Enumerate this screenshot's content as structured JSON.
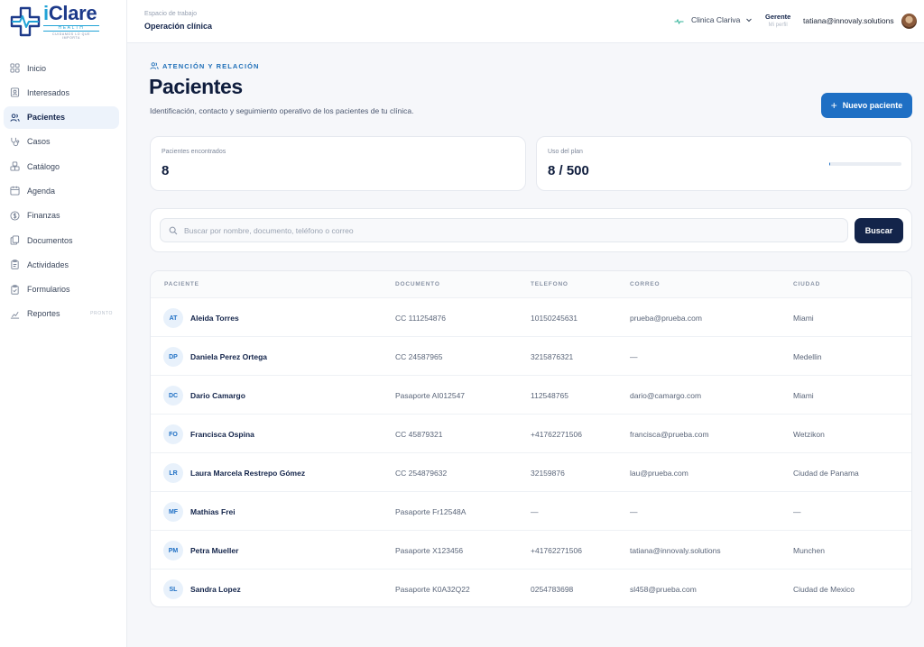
{
  "brand": {
    "name_i": "i",
    "name_rest": "Clare",
    "sub": "HEALTH",
    "tagline": "CUIDAMOS LO QUE IMPORTA"
  },
  "sidebar": {
    "items": [
      {
        "label": "Inicio",
        "icon": "grid-icon",
        "active": false,
        "badge": ""
      },
      {
        "label": "Interesados",
        "icon": "contact-card-icon",
        "active": false,
        "badge": ""
      },
      {
        "label": "Pacientes",
        "icon": "users-icon",
        "active": true,
        "badge": ""
      },
      {
        "label": "Casos",
        "icon": "stethoscope-icon",
        "active": false,
        "badge": ""
      },
      {
        "label": "Catálogo",
        "icon": "boxes-icon",
        "active": false,
        "badge": ""
      },
      {
        "label": "Agenda",
        "icon": "calendar-icon",
        "active": false,
        "badge": ""
      },
      {
        "label": "Finanzas",
        "icon": "dollar-circle-icon",
        "active": false,
        "badge": ""
      },
      {
        "label": "Documentos",
        "icon": "documents-icon",
        "active": false,
        "badge": ""
      },
      {
        "label": "Actividades",
        "icon": "clipboard-icon",
        "active": false,
        "badge": ""
      },
      {
        "label": "Formularios",
        "icon": "clipboard-check-icon",
        "active": false,
        "badge": ""
      },
      {
        "label": "Reportes",
        "icon": "chart-icon",
        "active": false,
        "badge": "PRONTO"
      }
    ]
  },
  "topbar": {
    "workspace_label": "Espacio de trabajo",
    "workspace_name": "Operación clínica",
    "clinic": "Clinica Clariva",
    "role": "Gerente",
    "role_sub": "Mi perfil",
    "email": "tatiana@innovaly.solutions"
  },
  "header": {
    "eyebrow": "ATENCIÓN Y RELACIÓN",
    "title": "Pacientes",
    "description": "Identificación, contacto y seguimiento operativo de los pacientes de tu clínica.",
    "new_button": "Nuevo paciente"
  },
  "stats": {
    "found_label": "Pacientes encontrados",
    "found_value": "8",
    "plan_label": "Uso del plan",
    "plan_value": "8 / 500",
    "plan_fraction": 0.016
  },
  "search": {
    "placeholder": "Buscar por nombre, documento, teléfono o correo",
    "value": "",
    "button": "Buscar"
  },
  "table": {
    "headers": {
      "patient": "PACIENTE",
      "document": "DOCUMENTO",
      "phone": "TELEFONO",
      "email": "CORREO",
      "city": "CIUDAD"
    },
    "rows": [
      {
        "initials": "AT",
        "name": "Aleida Torres",
        "document": "CC 111254876",
        "phone": "10150245631",
        "email": "prueba@prueba.com",
        "city": "Miami"
      },
      {
        "initials": "DP",
        "name": "Daniela Perez Ortega",
        "document": "CC 24587965",
        "phone": "3215876321",
        "email": "—",
        "city": "Medellin"
      },
      {
        "initials": "DC",
        "name": "Dario Camargo",
        "document": "Pasaporte AI012547",
        "phone": "112548765",
        "email": "dario@camargo.com",
        "city": "Miami"
      },
      {
        "initials": "FO",
        "name": "Francisca Ospina",
        "document": "CC 45879321",
        "phone": "+41762271506",
        "email": "francisca@prueba.com",
        "city": "Wetzikon"
      },
      {
        "initials": "LR",
        "name": "Laura Marcela Restrepo Gómez",
        "document": "CC 254879632",
        "phone": "32159876",
        "email": "lau@prueba.com",
        "city": "Ciudad de Panama"
      },
      {
        "initials": "MF",
        "name": "Mathias Frei",
        "document": "Pasaporte Fr12548A",
        "phone": "—",
        "email": "—",
        "city": "—"
      },
      {
        "initials": "PM",
        "name": "Petra Mueller",
        "document": "Pasaporte X123456",
        "phone": "+41762271506",
        "email": "tatiana@innovaly.solutions",
        "city": "Munchen"
      },
      {
        "initials": "SL",
        "name": "Sandra Lopez",
        "document": "Pasaporte K0A32Q22",
        "phone": "0254783698",
        "email": "sl458@prueba.com",
        "city": "Ciudad de Mexico"
      }
    ]
  },
  "colors": {
    "accent": "#1e6fc4",
    "navy": "#13244a",
    "brand_blue": "#1d3a8a",
    "brand_cyan": "#22a3d6"
  }
}
